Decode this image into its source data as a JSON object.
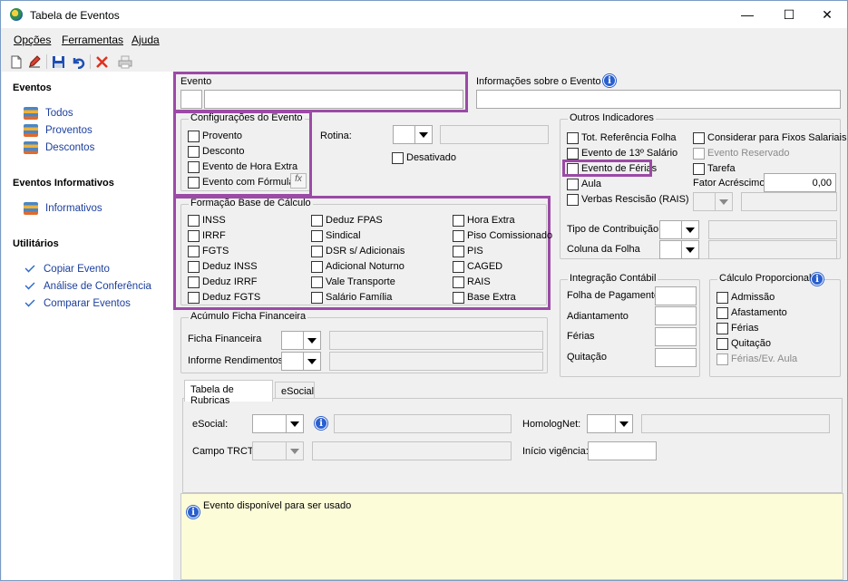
{
  "window": {
    "title": "Tabela de Eventos",
    "minimize": "—",
    "maximize": "☐",
    "close": "✕"
  },
  "menu": [
    {
      "label": "Opções"
    },
    {
      "label": "Ferramentas"
    },
    {
      "label": "Ajuda"
    }
  ],
  "toolbar": {
    "buttons": [
      "new-document-icon",
      "edit-pencil-icon",
      "save-disk-icon",
      "undo-icon",
      "delete-x-icon",
      "print-icon"
    ]
  },
  "sidebar": {
    "sections": [
      {
        "title": "Eventos",
        "items": [
          {
            "label": "Todos"
          },
          {
            "label": "Proventos"
          },
          {
            "label": "Descontos"
          }
        ]
      },
      {
        "title": "Eventos Informativos",
        "items": [
          {
            "label": "Informativos"
          }
        ]
      },
      {
        "title": "Utilitários",
        "items": [
          {
            "label": "Copiar Evento"
          },
          {
            "label": "Análise de Conferência"
          },
          {
            "label": "Comparar Eventos"
          }
        ]
      }
    ]
  },
  "evento": {
    "label": "Evento",
    "code": "",
    "name": ""
  },
  "info_evento": {
    "label": "Informações sobre o Evento",
    "value": ""
  },
  "config": {
    "title": "Configurações do Evento",
    "items": [
      "Provento",
      "Desconto",
      "Evento de Hora Extra",
      "Evento com Fórmula"
    ],
    "fx": "fx"
  },
  "rotina": {
    "label": "Rotina:",
    "value": "",
    "desc": ""
  },
  "desativado": "Desativado",
  "outros": {
    "title": "Outros Indicadores",
    "left": [
      "Tot. Referência Folha",
      "Evento de 13º Salário",
      "Evento de Férias",
      "Aula",
      "Verbas Rescisão (RAIS)"
    ],
    "right": [
      "Considerar para Fixos Salariais",
      "Evento Reservado",
      "Tarefa"
    ],
    "fator_label": "Fator Acréscimo",
    "fator_value": "0,00",
    "tipo_contrib": "Tipo de Contribuição",
    "coluna_folha": "Coluna da Folha"
  },
  "formacao": {
    "title": "Formação Base de Cálculo",
    "col1": [
      "INSS",
      "IRRF",
      "FGTS",
      "Deduz INSS",
      "Deduz IRRF",
      "Deduz FGTS"
    ],
    "col2": [
      "Deduz FPAS",
      "Sindical",
      "DSR s/ Adicionais",
      "Adicional Noturno",
      "Vale Transporte",
      "Salário Família"
    ],
    "col3": [
      "Hora Extra",
      "Piso Comissionado",
      "PIS",
      "CAGED",
      "RAIS",
      "Base Extra"
    ]
  },
  "acumulo": {
    "title": "Acúmulo Ficha Financeira",
    "ficha": "Ficha Financeira",
    "informe": "Informe Rendimentos"
  },
  "integracao": {
    "title": "Integração Contábil",
    "items": [
      "Folha de Pagamento",
      "Adiantamento",
      "Férias",
      "Quitação"
    ]
  },
  "proporcional": {
    "title": "Cálculo Proporcional",
    "items": [
      "Admissão",
      "Afastamento",
      "Férias",
      "Quitação",
      "Férias/Ev. Aula"
    ]
  },
  "tabs": [
    {
      "label": "Tabela de Rubricas"
    },
    {
      "label": "eSocial"
    }
  ],
  "esocial": {
    "esocial_label": "eSocial:",
    "homolog_label": "HomologNet:",
    "trct_label": "Campo TRCT:",
    "inicio_label": "Início vigência:",
    "inicio_value": ""
  },
  "status": {
    "message": "Evento disponível para ser usado"
  },
  "colors": {
    "highlight": "#9b4aa6",
    "link": "#1c3f9e",
    "info": "#2a5fcf",
    "message_bg": "#fcfcd9"
  }
}
